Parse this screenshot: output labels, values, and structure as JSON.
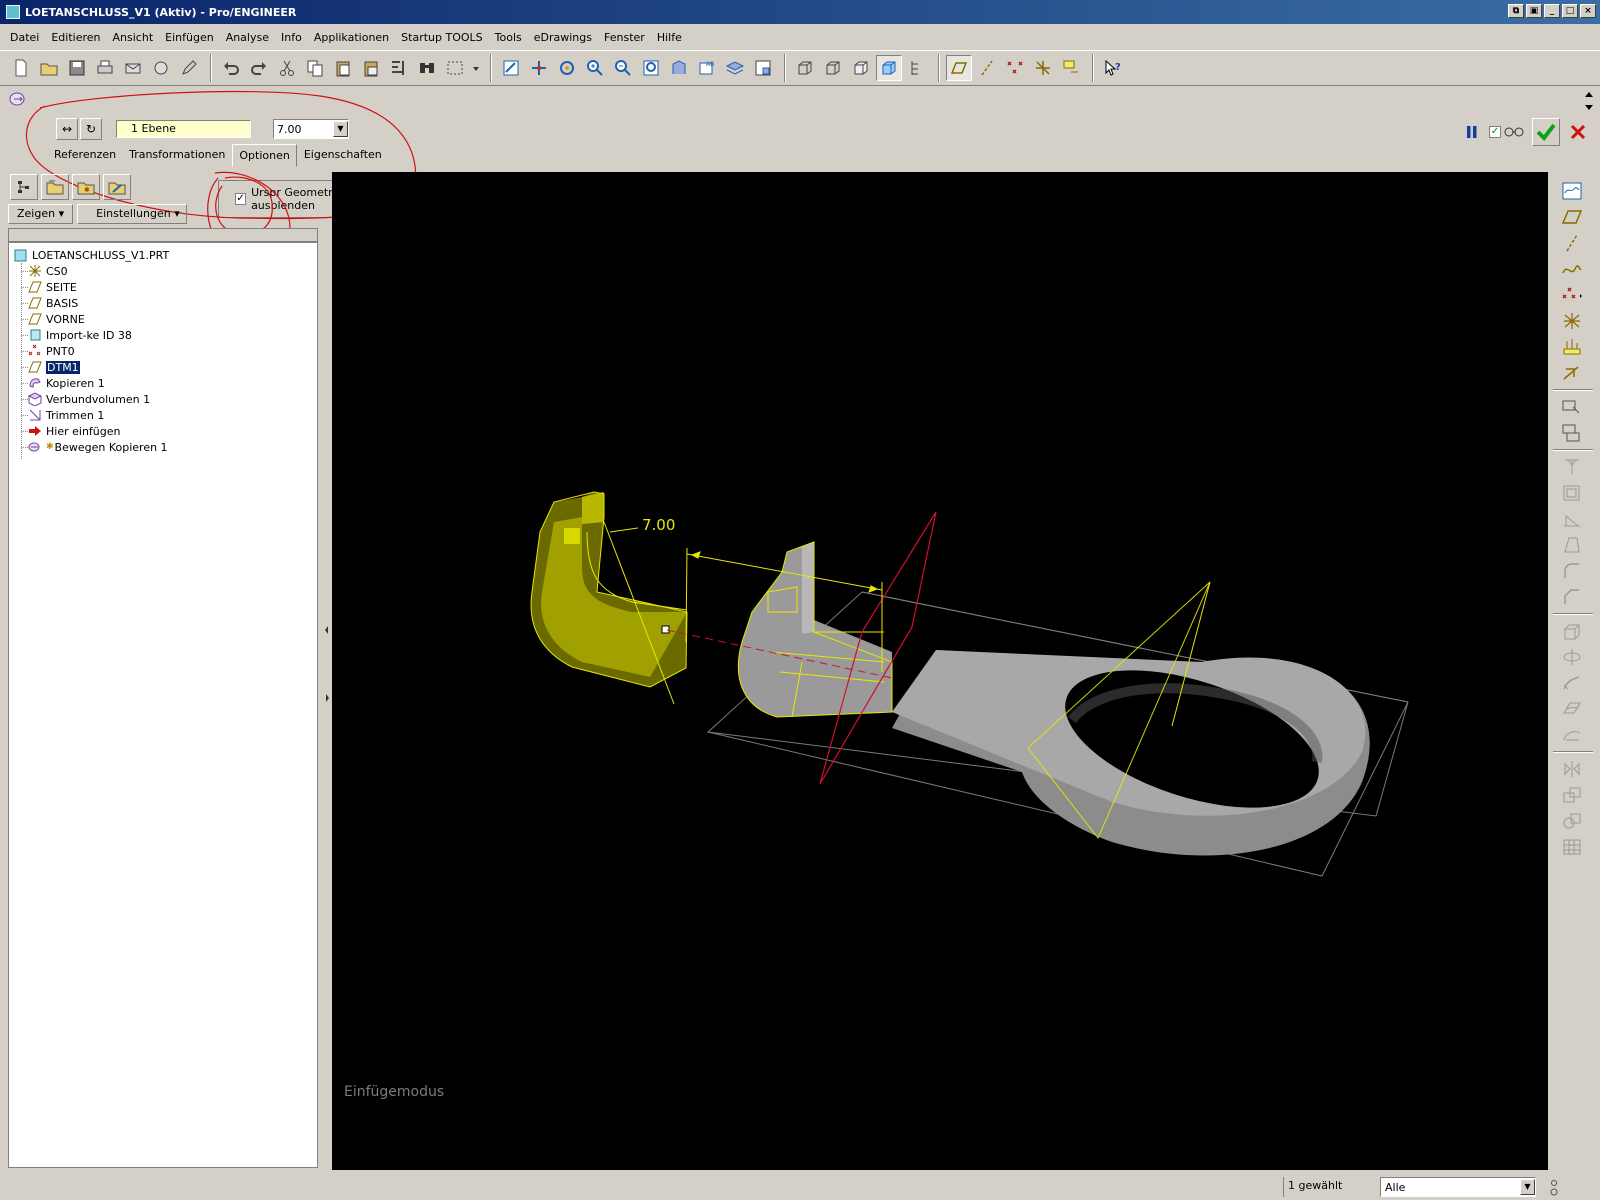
{
  "window": {
    "title": "LOETANSCHLUSS_V1 (Aktiv) - Pro/ENGINEER"
  },
  "menu": [
    "Datei",
    "Editieren",
    "Ansicht",
    "Einfügen",
    "Analyse",
    "Info",
    "Applikationen",
    "Startup TOOLS",
    "Tools",
    "eDrawings",
    "Fenster",
    "Hilfe"
  ],
  "dashboard": {
    "reference_field": "1 Ebene",
    "value": "7.00",
    "tabs": [
      "Referenzen",
      "Transformationen",
      "Optionen",
      "Eigenschaften"
    ],
    "active_tab": "Optionen",
    "option_checkbox_label": "Urspr Geometrie ausblenden",
    "option_checked": true
  },
  "left_panel": {
    "show_button": "Zeigen",
    "settings_button": "Einstellungen",
    "tree": {
      "root": "LOETANSCHLUSS_V1.PRT",
      "items": [
        {
          "label": "CS0",
          "icon": "coordinate-system-icon"
        },
        {
          "label": "SEITE",
          "icon": "datum-plane-icon"
        },
        {
          "label": "BASIS",
          "icon": "datum-plane-icon"
        },
        {
          "label": "VORNE",
          "icon": "datum-plane-icon"
        },
        {
          "label": "Import-ke ID 38",
          "icon": "import-feature-icon"
        },
        {
          "label": "PNT0",
          "icon": "datum-point-icon"
        },
        {
          "label": "DTM1",
          "icon": "datum-plane-icon",
          "selected": true
        },
        {
          "label": "Kopieren 1",
          "icon": "copy-feature-icon"
        },
        {
          "label": "Verbundvolumen 1",
          "icon": "merge-quilt-icon"
        },
        {
          "label": "Trimmen 1",
          "icon": "trim-feature-icon"
        },
        {
          "label": "Hier einfügen",
          "icon": "insert-here-arrow-icon"
        },
        {
          "label": "Bewegen Kopieren 1",
          "icon": "move-copy-icon"
        }
      ]
    }
  },
  "viewport": {
    "dimension_label": "7.00",
    "mode_label": "Einfügemodus"
  },
  "status": {
    "selected_count": "1 gewählt",
    "filter": "Alle"
  },
  "colors": {
    "selection_yellow": "#e8e800",
    "datum_red": "#d01030",
    "part_gray": "#a4a4a4"
  }
}
